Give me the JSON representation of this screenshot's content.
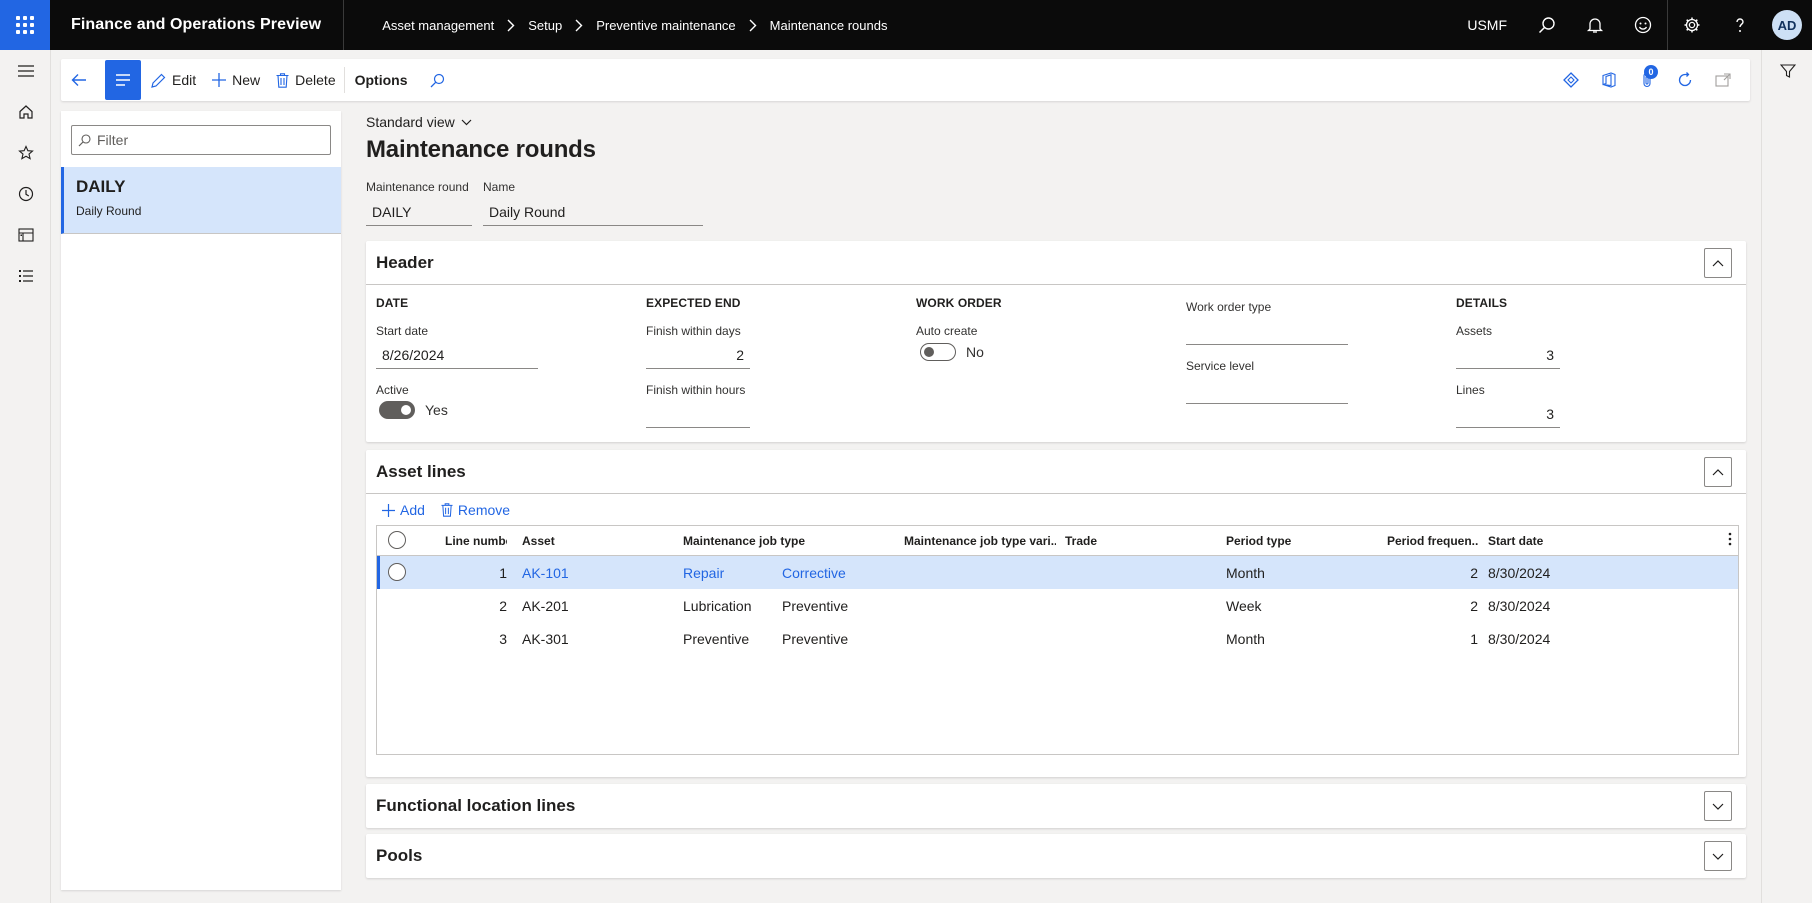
{
  "app": {
    "title": "Finance and Operations Preview",
    "breadcrumb": [
      "Asset management",
      "Setup",
      "Preventive maintenance",
      "Maintenance rounds"
    ],
    "company": "USMF",
    "user_initials": "AD"
  },
  "actions": {
    "edit": "Edit",
    "new": "New",
    "delete": "Delete",
    "options": "Options",
    "attachments_count": "0"
  },
  "list": {
    "filter_placeholder": "Filter",
    "items": [
      {
        "code": "DAILY",
        "name": "Daily Round"
      }
    ]
  },
  "page": {
    "view": "Standard view",
    "title": "Maintenance rounds",
    "fields": {
      "round_label": "Maintenance round",
      "round_value": "DAILY",
      "name_label": "Name",
      "name_value": "Daily Round"
    }
  },
  "header": {
    "title": "Header",
    "date": {
      "group": "DATE",
      "start_label": "Start date",
      "start_value": "8/26/2024",
      "active_label": "Active",
      "active_value": "Yes"
    },
    "expected_end": {
      "group": "EXPECTED END",
      "days_label": "Finish within days",
      "days_value": "2",
      "hours_label": "Finish within hours",
      "hours_value": ""
    },
    "work_order": {
      "group": "WORK ORDER",
      "auto_label": "Auto create",
      "auto_value": "No"
    },
    "wo_type": {
      "type_label": "Work order type",
      "type_value": "",
      "service_label": "Service level",
      "service_value": ""
    },
    "details": {
      "group": "DETAILS",
      "assets_label": "Assets",
      "assets_value": "3",
      "lines_label": "Lines",
      "lines_value": "3"
    }
  },
  "asset_lines": {
    "title": "Asset lines",
    "add": "Add",
    "remove": "Remove",
    "columns": [
      "Line number",
      "Asset",
      "Maintenance job type",
      "Maintenance job type vari...",
      "Trade",
      "Period type",
      "Period frequen...",
      "Start date"
    ],
    "rows": [
      {
        "line": "1",
        "asset": "AK-101",
        "job_type": "Repair",
        "variant": "Corrective",
        "trade": "",
        "period_type": "Month",
        "frequency": "2",
        "start": "8/30/2024"
      },
      {
        "line": "2",
        "asset": "AK-201",
        "job_type": "Lubrication",
        "variant": "Preventive",
        "trade": "",
        "period_type": "Week",
        "frequency": "2",
        "start": "8/30/2024"
      },
      {
        "line": "3",
        "asset": "AK-301",
        "job_type": "Preventive",
        "variant": "Preventive",
        "trade": "",
        "period_type": "Month",
        "frequency": "1",
        "start": "8/30/2024"
      }
    ]
  },
  "sections": {
    "functional": "Functional location lines",
    "pools": "Pools"
  },
  "colors": {
    "accent": "#2266e3",
    "selection": "#d5e5fb",
    "topbar": "#0b0b0b"
  }
}
